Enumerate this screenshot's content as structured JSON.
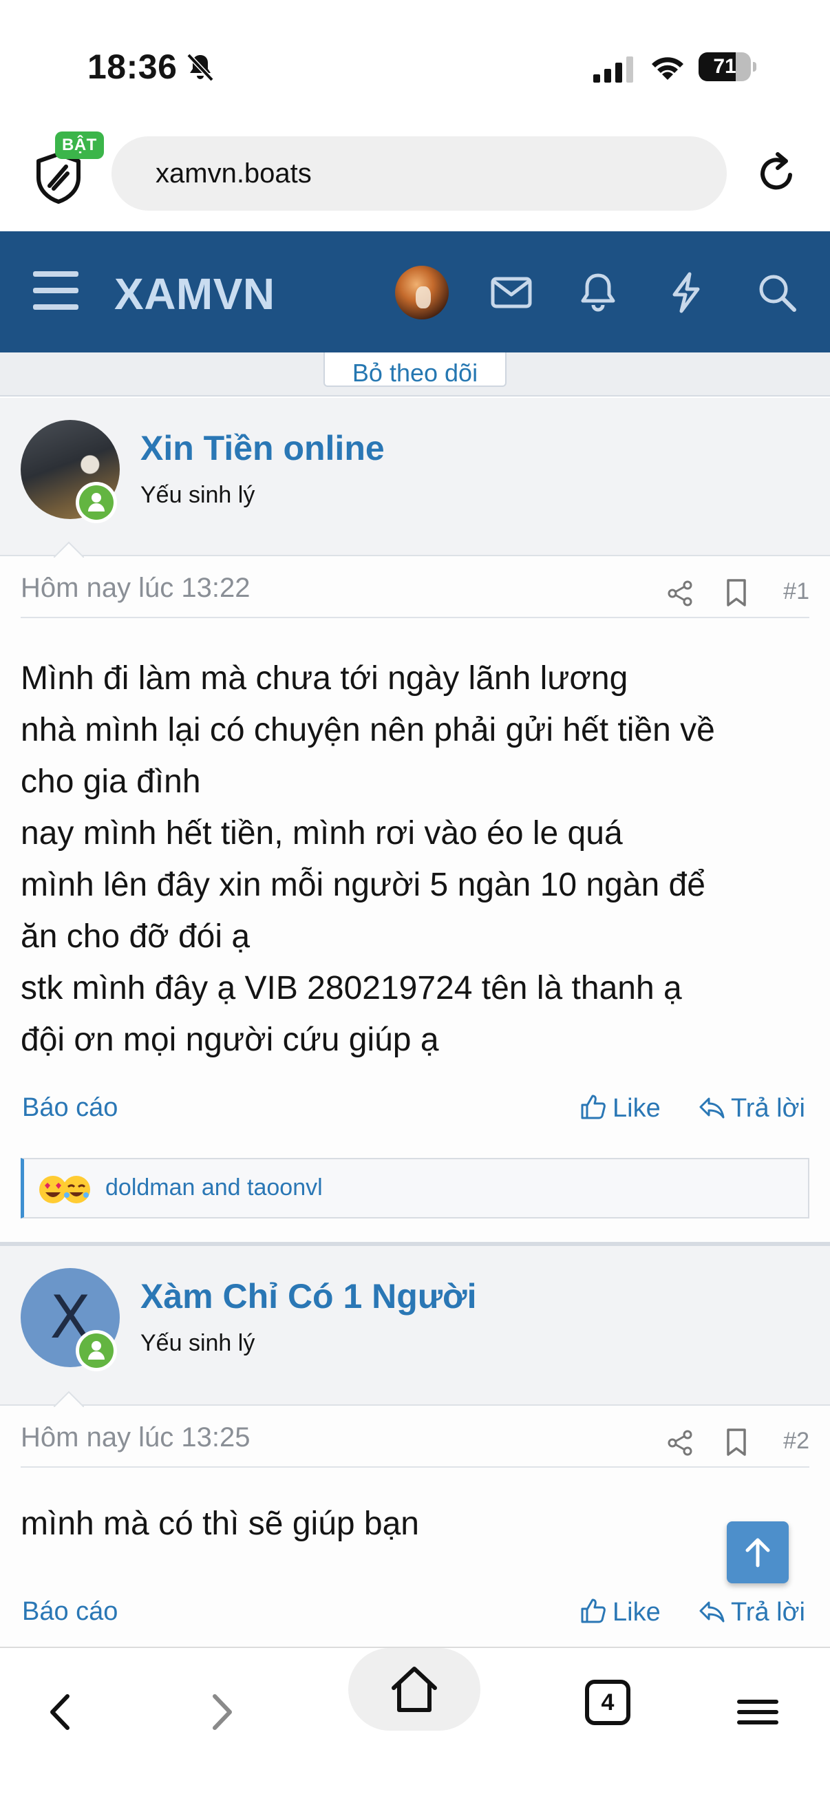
{
  "status_bar": {
    "time": "18:36",
    "battery": "71",
    "battery_level": 0.71
  },
  "browser": {
    "url": "xamvn.boats",
    "shield_badge": "BẬT",
    "tab_count": "4"
  },
  "site": {
    "logo": "XAMVN"
  },
  "unfollow_button": "Bỏ theo dõi",
  "posts": [
    {
      "username": "Xin Tiền online",
      "user_title": "Yếu sinh lý",
      "date": "Hôm nay lúc 13:22",
      "number": "#1",
      "body": [
        "Mình đi làm mà chưa tới ngày lãnh lương",
        "nhà mình lại có chuyện nên phải gửi hết tiền về",
        "cho gia đình",
        "nay mình hết tiền, mình rơi vào éo le quá",
        "mình lên đây xin mỗi người 5 ngàn 10 ngàn để",
        "ăn cho đỡ đói ạ",
        "stk mình đây ạ VIB 280219724 tên là thanh ạ",
        "đội ơn mọi người cứu giúp ạ"
      ],
      "report": "Báo cáo",
      "like": "Like",
      "reply": "Trả lời",
      "reactions": "doldman and taoonvl"
    },
    {
      "username": "Xàm Chỉ Có 1 Người",
      "user_title": "Yếu sinh lý",
      "avatar_letter": "X",
      "date": "Hôm nay lúc 13:25",
      "number": "#2",
      "body": [
        "mình mà có thì sẽ giúp bạn"
      ],
      "report": "Báo cáo",
      "like": "Like",
      "reply": "Trả lời"
    }
  ],
  "colors": {
    "header": "#1d5184",
    "link": "#2a77b5",
    "online": "#63b541",
    "badge": "#3bb54a"
  }
}
